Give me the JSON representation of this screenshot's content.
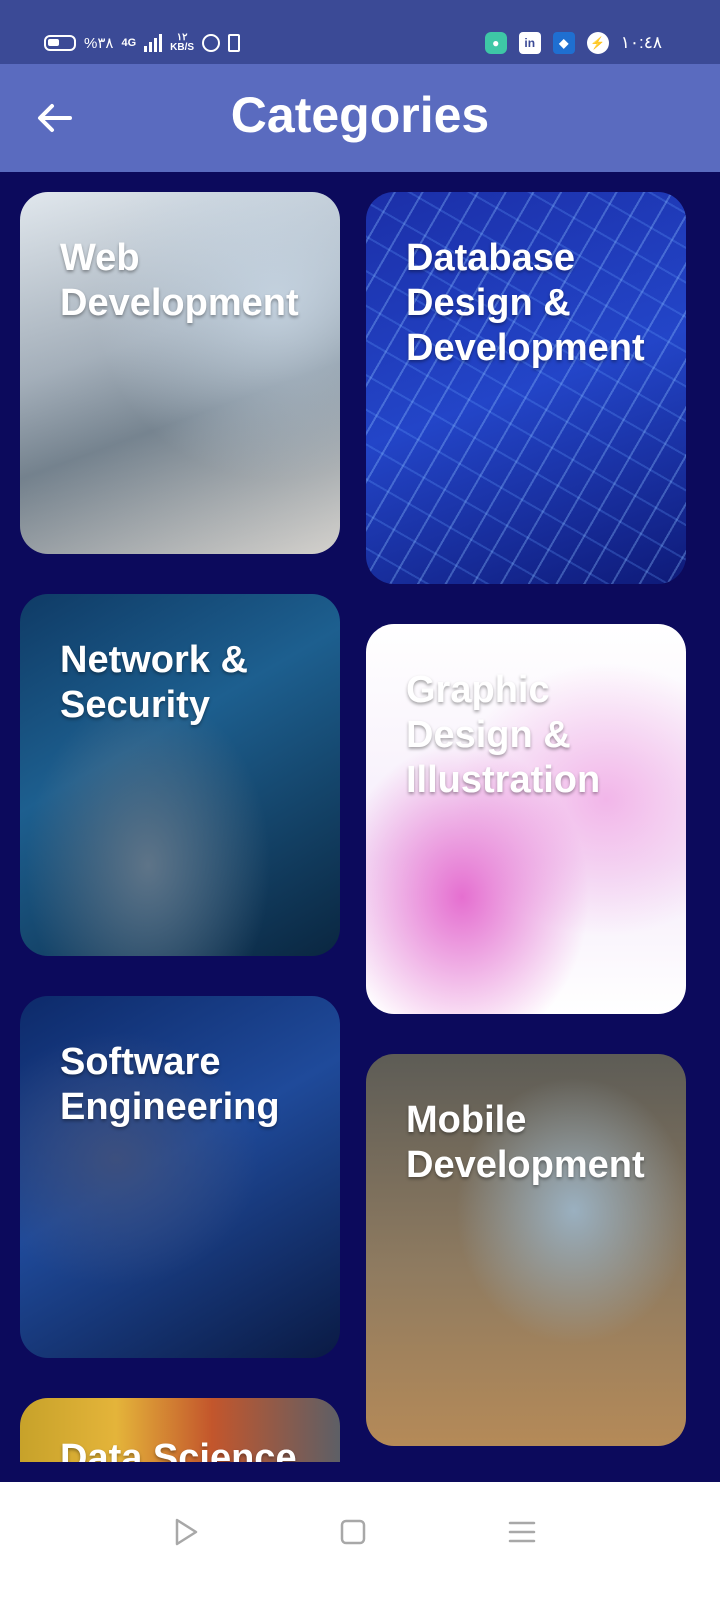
{
  "status_bar": {
    "battery_text": "%٣٨",
    "network": "4G",
    "speed_value": "١٢",
    "speed_unit": "KB/S",
    "time": "١٠:٤٨",
    "linkedin_icon_text": "in"
  },
  "app_bar": {
    "title": "Categories"
  },
  "categories": [
    {
      "label": "Web Development"
    },
    {
      "label": "Database Design & Development"
    },
    {
      "label": "Network & Security"
    },
    {
      "label": "Graphic Design & Illustration"
    },
    {
      "label": "Software Engineering"
    },
    {
      "label": "Mobile Development"
    },
    {
      "label": "Data Science"
    }
  ],
  "icons": {
    "back": "arrow-left-icon",
    "nav_back": "triangle-back-icon",
    "nav_home": "square-home-icon",
    "nav_menu": "menu-lines-icon"
  }
}
